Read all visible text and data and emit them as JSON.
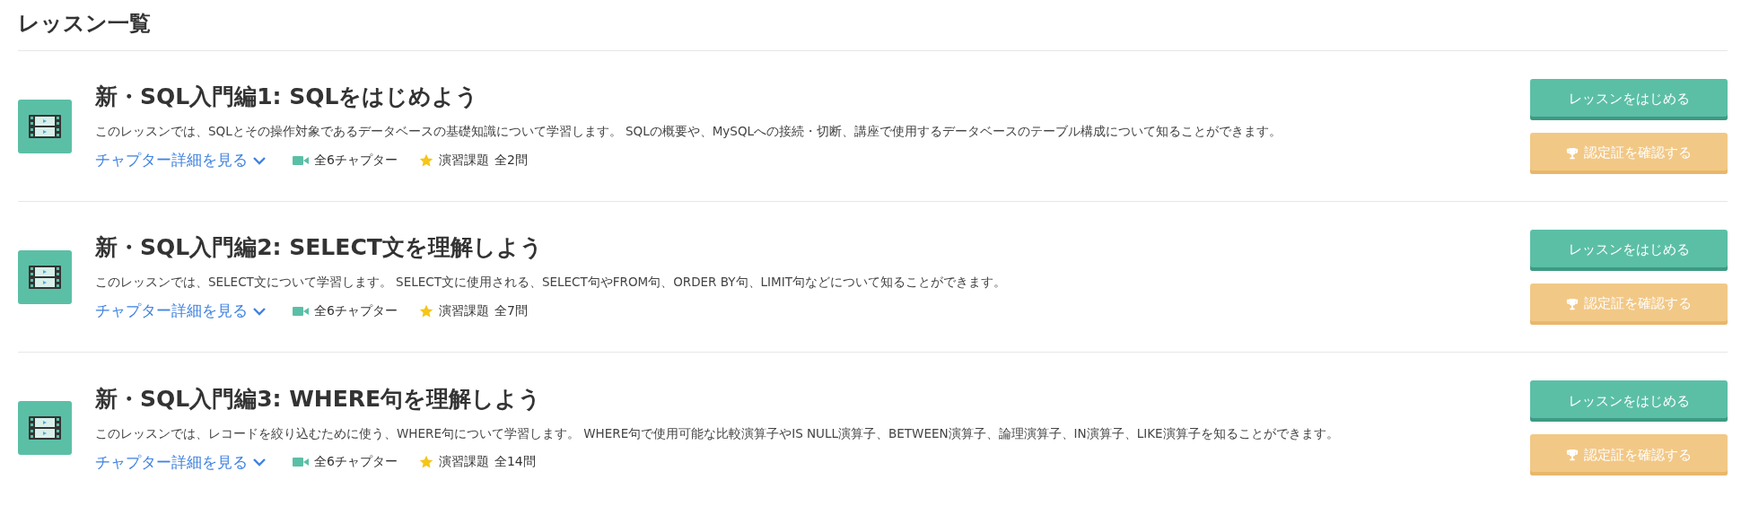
{
  "heading": "レッスン一覧",
  "lessons": [
    {
      "title": "新・SQL入門編1: SQLをはじめよう",
      "description": "このレッスンでは、SQLとその操作対象であるデータベースの基礎知識について学習します。 SQLの概要や、MySQLへの接続・切断、講座で使用するデータベースのテーブル構成について知ることができます。",
      "details_link": "チャプター詳細を見る",
      "chapters": "全6チャプター",
      "exercises_label": "演習課題",
      "exercises_count": "全2問",
      "start_button": "レッスンをはじめる",
      "certificate_button": "認定証を確認する"
    },
    {
      "title": "新・SQL入門編2: SELECT文を理解しよう",
      "description": "このレッスンでは、SELECT文について学習します。 SELECT文に使用される、SELECT句やFROM句、ORDER BY句、LIMIT句などについて知ることができます。",
      "details_link": "チャプター詳細を見る",
      "chapters": "全6チャプター",
      "exercises_label": "演習課題",
      "exercises_count": "全7問",
      "start_button": "レッスンをはじめる",
      "certificate_button": "認定証を確認する"
    },
    {
      "title": "新・SQL入門編3: WHERE句を理解しよう",
      "description": "このレッスンでは、レコードを絞り込むために使う、WHERE句について学習します。 WHERE句で使用可能な比較演算子やIS NULL演算子、BETWEEN演算子、論理演算子、IN演算子、LIKE演算子を知ることができます。",
      "details_link": "チャプター詳細を見る",
      "chapters": "全6チャプター",
      "exercises_label": "演習課題",
      "exercises_count": "全14問",
      "start_button": "レッスンをはじめる",
      "certificate_button": "認定証を確認する"
    }
  ]
}
